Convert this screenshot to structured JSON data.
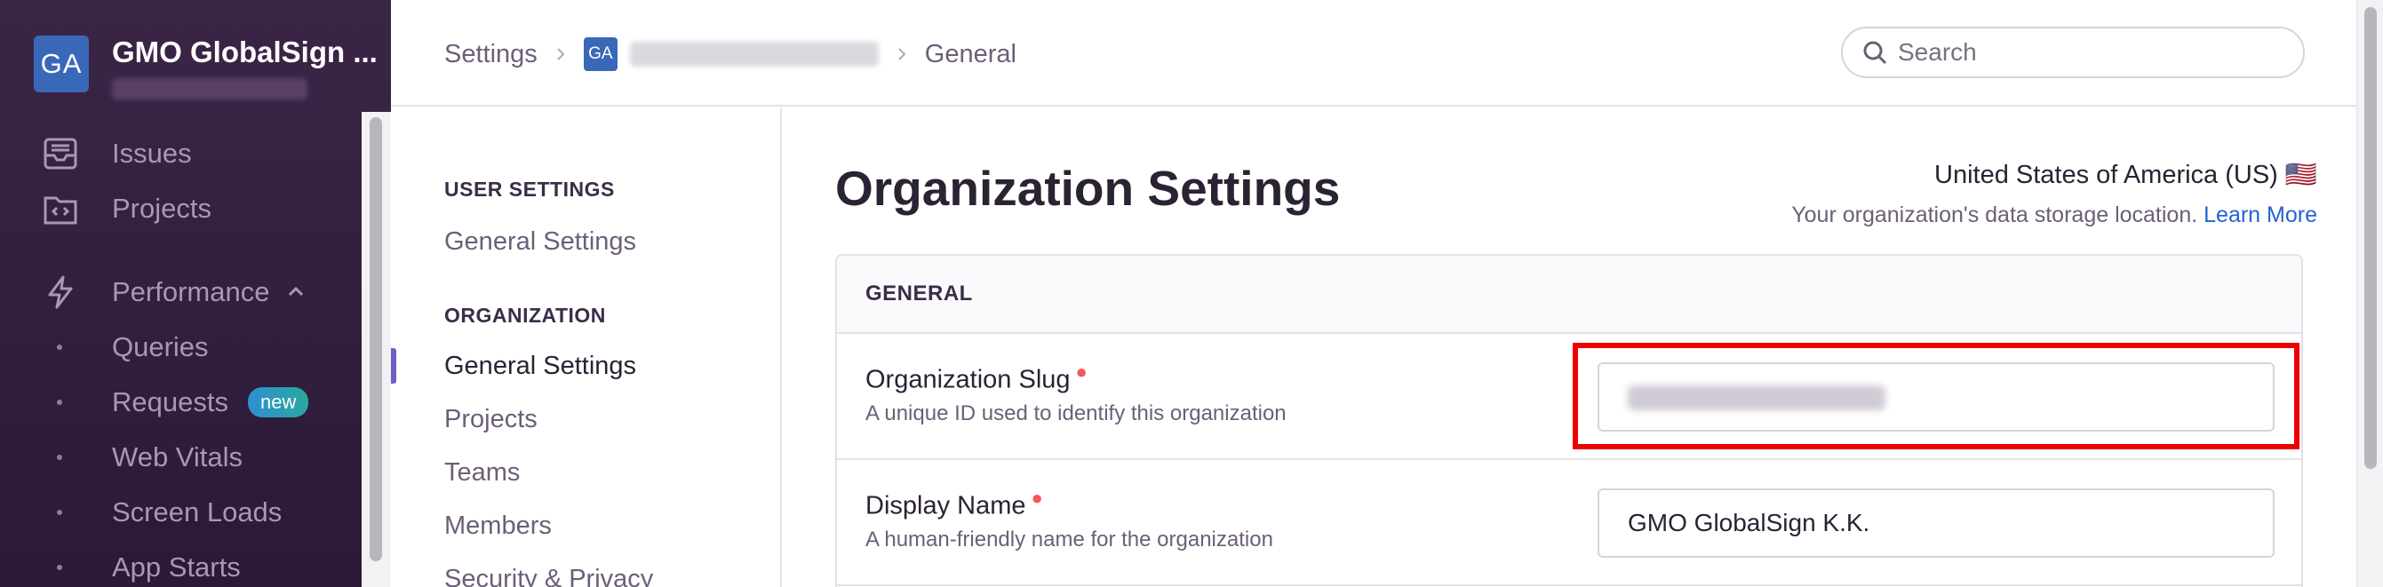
{
  "sidebar": {
    "org_avatar": "GA",
    "org_name": "GMO GlobalSign ...",
    "nav": [
      {
        "label": "Issues",
        "icon": "issues-icon"
      },
      {
        "label": "Projects",
        "icon": "projects-icon"
      },
      {
        "label": "Performance",
        "icon": "performance-icon"
      }
    ],
    "performance_sub": [
      {
        "label": "Queries"
      },
      {
        "label": "Requests",
        "badge": "new"
      },
      {
        "label": "Web Vitals"
      },
      {
        "label": "Screen Loads"
      },
      {
        "label": "App Starts"
      }
    ]
  },
  "topbar": {
    "breadcrumb_settings": "Settings",
    "breadcrumb_avatar": "GA",
    "breadcrumb_general": "General",
    "search_placeholder": "Search"
  },
  "settings_nav": {
    "user_heading": "USER SETTINGS",
    "user_links": [
      "General Settings"
    ],
    "org_heading": "ORGANIZATION",
    "org_links": [
      "General Settings",
      "Projects",
      "Teams",
      "Members",
      "Security & Privacy"
    ],
    "active_link": "General Settings"
  },
  "main": {
    "title": "Organization Settings",
    "region_name": "United States of America (US) 🇺🇸",
    "region_desc": "Your organization's data storage location.",
    "region_link": "Learn More",
    "panel_heading": "GENERAL",
    "fields": [
      {
        "label": "Organization Slug",
        "help": "A unique ID used to identify this organization",
        "value": ""
      },
      {
        "label": "Display Name",
        "help": "A human-friendly name for the organization",
        "value": "GMO GlobalSign K.K."
      }
    ]
  },
  "colors": {
    "sidebar_bg": "#32203f",
    "accent": "#6c5fc7",
    "link": "#2562d4",
    "highlight": "#ee0000",
    "avatar": "#3a68b8"
  }
}
